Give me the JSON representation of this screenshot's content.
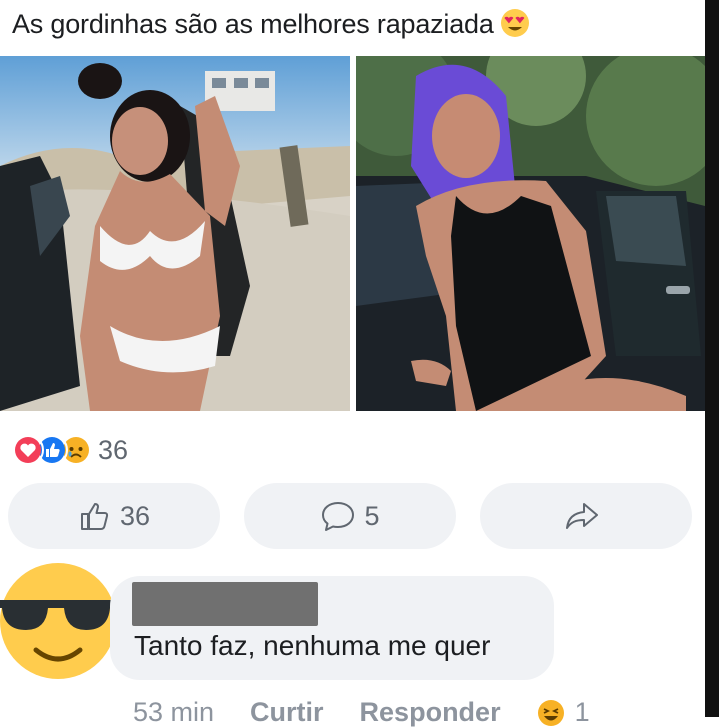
{
  "post": {
    "text": "As gordinhas são as melhores rapaziada",
    "text_emoji": "heart-eyes-emoji"
  },
  "photos": [
    {
      "name": "beach-photo"
    },
    {
      "name": "car-photo"
    }
  ],
  "reactions": {
    "icons": [
      "love-reaction-icon",
      "like-reaction-icon",
      "sad-reaction-icon"
    ],
    "count": "36"
  },
  "actions": {
    "like_count": "36",
    "comment_count": "5"
  },
  "comment": {
    "avatar": "sunglasses-emoji-avatar",
    "text": "Tanto faz, nenhuma me quer",
    "time": "53 min",
    "like_label": "Curtir",
    "reply_label": "Responder",
    "reaction_count": "1"
  },
  "colors": {
    "bubble": "#f0f2f5",
    "secondary_text": "#606770",
    "like_blue": "#1877f2",
    "love_red": "#f33e58"
  }
}
